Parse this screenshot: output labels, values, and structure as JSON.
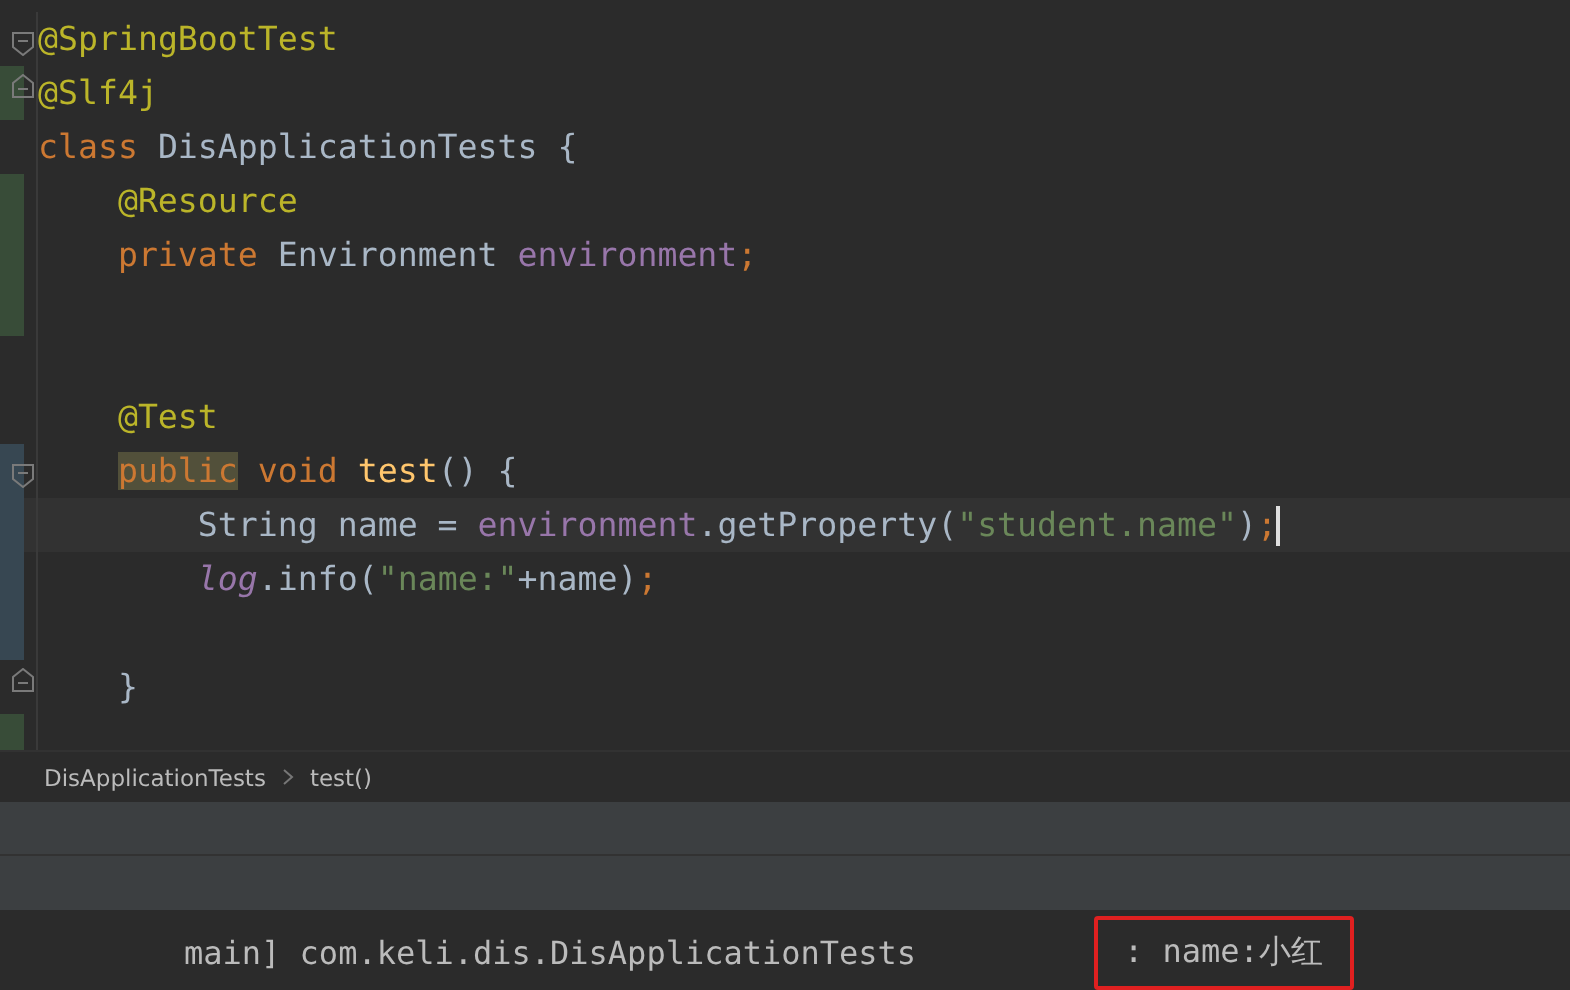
{
  "editor": {
    "lines": [
      {
        "fold_start": true,
        "fold_end": false,
        "added": false,
        "modified": false,
        "current": false,
        "tokens": [
          {
            "text": "@SpringBootTest",
            "kind": "annotation"
          }
        ]
      },
      {
        "fold_start": false,
        "fold_end": true,
        "added": true,
        "modified": false,
        "current": false,
        "tokens": [
          {
            "text": "@Slf4j",
            "kind": "annotation"
          }
        ]
      },
      {
        "fold_start": false,
        "fold_end": false,
        "added": false,
        "modified": false,
        "current": false,
        "tokens": [
          {
            "text": "class",
            "kind": "keyword"
          },
          {
            "text": " DisApplicationTests {",
            "kind": "plain"
          }
        ]
      },
      {
        "fold_start": false,
        "fold_end": false,
        "added": true,
        "modified": false,
        "current": false,
        "tokens": [
          {
            "text": "    @Resource",
            "kind": "annotation"
          }
        ]
      },
      {
        "fold_start": false,
        "fold_end": false,
        "added": true,
        "modified": false,
        "current": false,
        "tokens": [
          {
            "text": "    private",
            "kind": "keyword"
          },
          {
            "text": " Environment ",
            "kind": "plain"
          },
          {
            "text": "environment",
            "kind": "field"
          },
          {
            "text": ";",
            "kind": "keyword"
          }
        ]
      },
      {
        "fold_start": false,
        "fold_end": false,
        "added": true,
        "modified": false,
        "current": false
      },
      {
        "fold_start": false,
        "fold_end": false,
        "added": false,
        "modified": false,
        "current": false
      },
      {
        "fold_start": false,
        "fold_end": false,
        "added": false,
        "modified": false,
        "current": false,
        "tokens": [
          {
            "text": "    @Test",
            "kind": "annotation"
          }
        ]
      },
      {
        "fold_start": true,
        "fold_end": false,
        "added": false,
        "modified": true,
        "current": false,
        "tokens": [
          {
            "text": "    public",
            "kind": "keyword",
            "highlighted": true
          },
          {
            "text": " void ",
            "kind": "keyword"
          },
          {
            "text": "test",
            "kind": "method"
          },
          {
            "text": "() {",
            "kind": "plain"
          }
        ]
      },
      {
        "fold_start": false,
        "fold_end": false,
        "added": false,
        "modified": true,
        "current": true,
        "tokens": [
          {
            "text": "        String name = ",
            "kind": "plain"
          },
          {
            "text": "environment",
            "kind": "field"
          },
          {
            "text": ".getProperty(",
            "kind": "plain"
          },
          {
            "text": "\"student.name\"",
            "kind": "string"
          },
          {
            "text": ")",
            "kind": "plain"
          },
          {
            "text": ";",
            "kind": "keyword"
          }
        ]
      },
      {
        "fold_start": false,
        "fold_end": false,
        "added": false,
        "modified": true,
        "current": false,
        "tokens": [
          {
            "text": "        log",
            "kind": "static"
          },
          {
            "text": ".info(",
            "kind": "plain"
          },
          {
            "text": "\"name:\"",
            "kind": "string"
          },
          {
            "text": "+name)",
            "kind": "plain"
          },
          {
            "text": ";",
            "kind": "keyword"
          }
        ]
      },
      {
        "fold_start": false,
        "fold_end": false,
        "added": false,
        "modified": true,
        "current": false
      },
      {
        "fold_start": false,
        "fold_end": true,
        "added": false,
        "modified": false,
        "current": false,
        "tokens": [
          {
            "text": "    }",
            "kind": "plain"
          }
        ]
      },
      {
        "fold_start": false,
        "fold_end": false,
        "added": true,
        "modified": false,
        "current": false
      }
    ]
  },
  "breadcrumbs": [
    "DisApplicationTests",
    "test()"
  ],
  "console": {
    "source": "main] com.keli.dis.DisApplicationTests",
    "message": ": name:小红",
    "message_highlighted": true
  }
}
